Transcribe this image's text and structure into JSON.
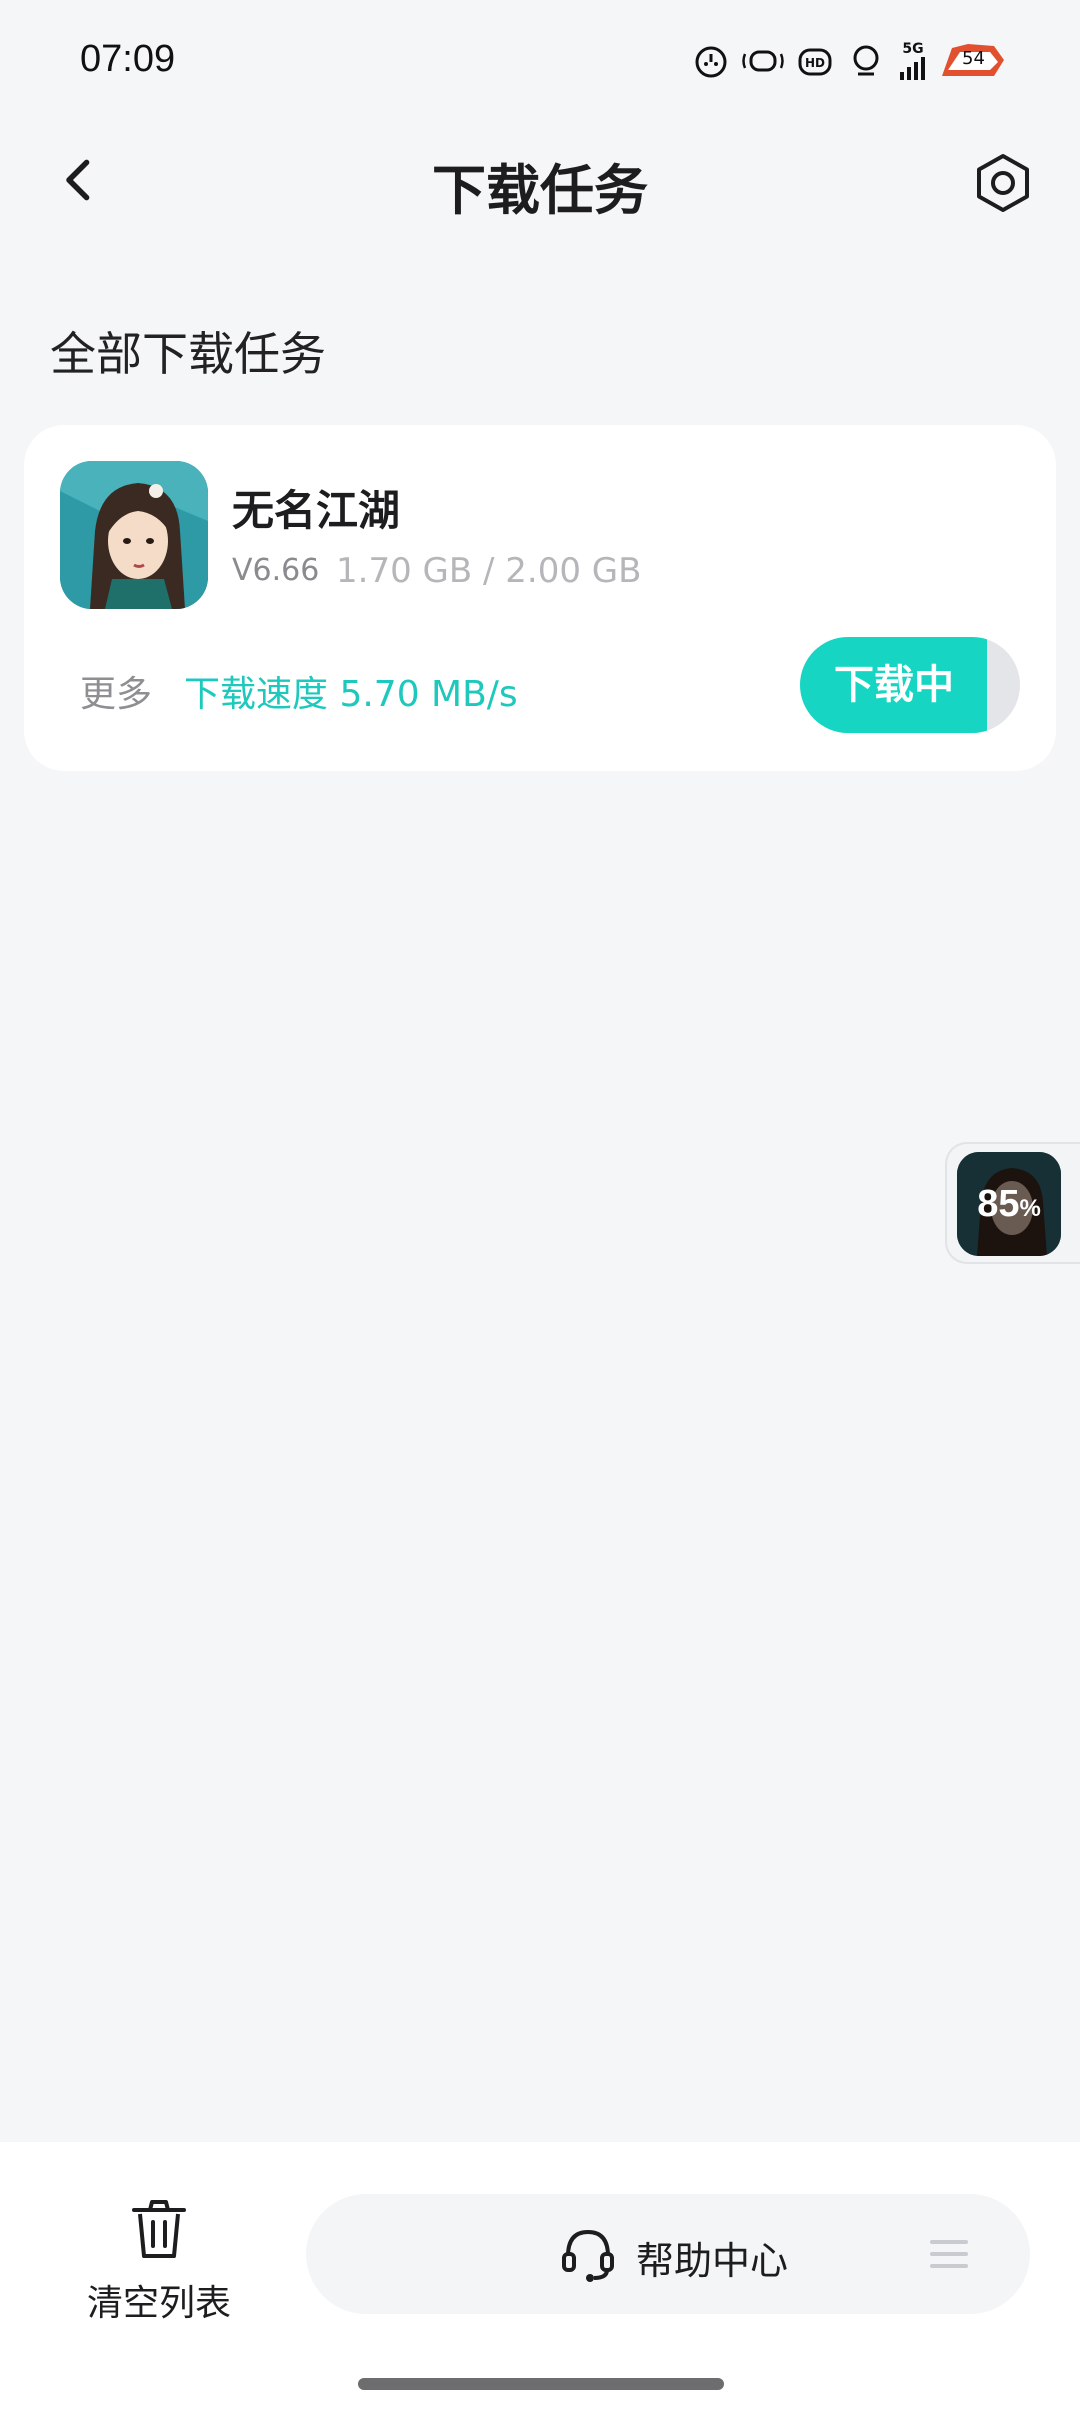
{
  "status_bar": {
    "time": "07:09",
    "network": "5G",
    "battery": "54",
    "icons": [
      "alarm-icon",
      "wifi-sound-icon",
      "hd-icon",
      "notification-icon",
      "signal-icon",
      "battery-icon"
    ]
  },
  "header": {
    "title": "下载任务",
    "back_icon": "chevron-left-icon",
    "settings_icon": "hexagon-settings-icon"
  },
  "section": {
    "title": "全部下载任务"
  },
  "task": {
    "app_name": "无名江湖",
    "version": "V6.66",
    "size": "1.70 GB / 2.00 GB",
    "more_label": "更多",
    "speed_label": "下载速度 5.70 MB/s",
    "button_label": "下载中",
    "progress_fraction": 0.85,
    "accent_color": "#16d6c3"
  },
  "floating": {
    "percent_value": "85",
    "percent_sign": "%"
  },
  "bottom_bar": {
    "clear_label": "清空列表",
    "help_label": "帮助中心",
    "clear_icon": "trash-icon",
    "help_icon": "headset-icon",
    "menu_icon": "menu-icon"
  }
}
